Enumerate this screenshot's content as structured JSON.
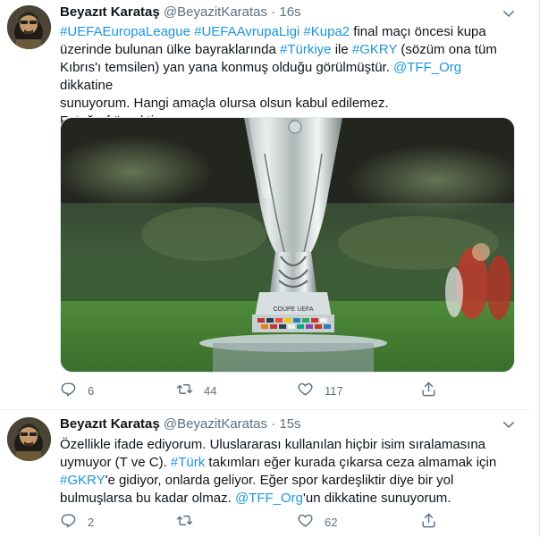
{
  "tweets": [
    {
      "author_name": "Beyazıt Karataş",
      "author_handle": "@BeyazitKaratas",
      "separator": "·",
      "time": "16s",
      "text_lines": [
        [
          {
            "t": "#UEFAEuropaLeague",
            "link": true
          },
          {
            "t": " ",
            "link": false
          },
          {
            "t": "#UEFAAvrupaLigi",
            "link": true
          },
          {
            "t": " ",
            "link": false
          },
          {
            "t": "#Kupa2",
            "link": true
          },
          {
            "t": " final maçı öncesi kupa",
            "link": false
          }
        ],
        [
          {
            "t": "üzerinde bulunan ülke bayraklarında  ",
            "link": false
          },
          {
            "t": "#Türkiye",
            "link": true
          },
          {
            "t": " ile ",
            "link": false
          },
          {
            "t": "#GKRY",
            "link": true
          },
          {
            "t": " (sözüm ona tüm",
            "link": false
          }
        ],
        [
          {
            "t": "Kıbrıs'ı temsilen) yan yana konmuş olduğu görülmüştür. ",
            "link": false
          },
          {
            "t": "@TFF_Org",
            "link": true
          },
          {
            "t": " dikkatine",
            "link": false
          }
        ],
        [
          {
            "t": "sunuyorum. Hangi amaçla olursa olsun kabul edilemez.",
            "link": false
          }
        ],
        [
          {
            "t": "Fotoğraf örnektir.",
            "link": false
          }
        ]
      ],
      "photo": {
        "trophy_text": "COUPE UEFA"
      },
      "actions": {
        "replies": "6",
        "retweets": "44",
        "likes": "117"
      }
    },
    {
      "author_name": "Beyazıt Karataş",
      "author_handle": "@BeyazitKaratas",
      "separator": "·",
      "time": "15s",
      "text_lines": [
        [
          {
            "t": "Özellikle ifade ediyorum. Uluslararası kullanılan hiçbir isim sıralamasına",
            "link": false
          }
        ],
        [
          {
            "t": "uymuyor (T ve C). ",
            "link": false
          },
          {
            "t": "#Türk",
            "link": true
          },
          {
            "t": " takımları eğer kurada çıkarsa ceza almamak için",
            "link": false
          }
        ],
        [
          {
            "t": "#GKRY",
            "link": true
          },
          {
            "t": "'e gidiyor, onlarda geliyor. Eğer spor kardeşliktir diye bir yol",
            "link": false
          }
        ],
        [
          {
            "t": "bulmuşlarsa bu kadar olmaz. ",
            "link": false
          },
          {
            "t": "@TFF_Org",
            "link": true
          },
          {
            "t": "'un dikkatine sunuyorum.",
            "link": false
          }
        ]
      ],
      "actions": {
        "replies": "2",
        "retweets": "",
        "likes": "62"
      }
    }
  ],
  "icons": {
    "reply": "reply-icon",
    "retweet": "retweet-icon",
    "like": "heart-icon",
    "share": "share-icon",
    "caret": "chevron-down-icon"
  },
  "colors": {
    "link": "#1b95e0",
    "muted": "#5b7083",
    "text": "#0f1419"
  }
}
